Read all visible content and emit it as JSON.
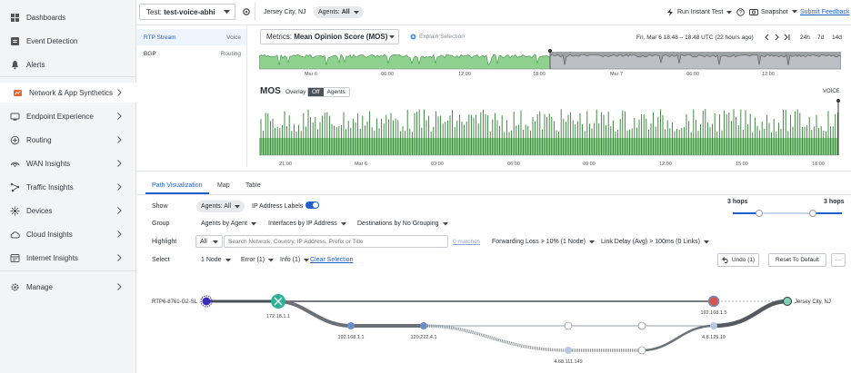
{
  "sidebar": {
    "items": [
      {
        "label": "Dashboards",
        "icon": "dashboard-icon"
      },
      {
        "label": "Event Detection",
        "icon": "event-detection-icon"
      },
      {
        "label": "Alerts",
        "icon": "bell-icon"
      },
      {
        "label": "Network & App Synthetics",
        "icon": "synthetics-icon"
      },
      {
        "label": "Endpoint Experience",
        "icon": "endpoint-icon"
      },
      {
        "label": "Routing",
        "icon": "routing-icon"
      },
      {
        "label": "WAN Insights",
        "icon": "wan-icon"
      },
      {
        "label": "Traffic Insights",
        "icon": "traffic-icon"
      },
      {
        "label": "Devices",
        "icon": "devices-icon"
      },
      {
        "label": "Cloud Insights",
        "icon": "cloud-icon"
      },
      {
        "label": "Internet Insights",
        "icon": "internet-icon"
      },
      {
        "label": "Manage",
        "icon": "gear-icon"
      }
    ]
  },
  "header": {
    "test_prefix": "Test:",
    "test_name": "test-voice-abhi",
    "location": "Jersey City, NJ",
    "agents_label": "Agents:",
    "agents_value": "All",
    "run_instant_test": "Run Instant Test",
    "snapshot": "Snapshot",
    "submit_feedback": "Submit Feedback"
  },
  "test_list": [
    {
      "name": "RTP Stream",
      "type": "Voice",
      "selected": true
    },
    {
      "name": "BGP",
      "type": "Routing",
      "selected": false
    }
  ],
  "metrics": {
    "label": "Metrics:",
    "value": "Mean Opinion Score (MOS)",
    "explain": "Explain Selection",
    "time_range": "Fri, Mar 6 18:48 – 18:48 UTC (22 hours ago)",
    "ranges": [
      "24h",
      "7d",
      "14d"
    ]
  },
  "timeline": {
    "ticks": [
      "Mar 6",
      "06:00",
      "12:00",
      "18:00",
      "Mar 7",
      "06:00",
      "12:00"
    ]
  },
  "mos_chart": {
    "title": "MOS",
    "overlay_label": "Overlay",
    "overlay_off": "Off",
    "overlay_agents": "Agents",
    "voice_label": "VOICE",
    "ticks": [
      "21:00",
      "Mar 6",
      "03:00",
      "06:00",
      "09:00",
      "12:00",
      "15:00",
      "18:00"
    ]
  },
  "tabs": [
    "Path Visualization",
    "Map",
    "Table"
  ],
  "controls": {
    "show_label": "Show",
    "agents_all": "Agents: All",
    "ip_labels": "IP Address Labels",
    "hops_left": "3 hops",
    "hops_right": "3 hops",
    "group_label": "Group",
    "group_by_agent": "Agents by Agent",
    "group_interfaces": "Interfaces by IP Address",
    "group_destinations": "Destinations by No Grouping",
    "highlight_label": "Highlight",
    "highlight_scope": "All",
    "search_placeholder": "Search Network, Country, IP Address, Prefix or Title",
    "matches": "0 matches",
    "forwarding_loss": "Forwarding Loss > 10% (1 Node)",
    "link_delay": "Link Delay (Avg) > 100ms (0 Links)",
    "select_label": "Select",
    "node_count": "1 Node",
    "error_count": "Error (1)",
    "info_count": "Info (1)",
    "clear_selection": "Clear Selection",
    "undo": "Undo (1)",
    "reset": "Reset To Default",
    "more": "···"
  },
  "path": {
    "source": "RTP6-8761-G2-SL",
    "destination": "Jersey City, NJ",
    "nodes": [
      "172.18.1.1",
      "192.168.1.1",
      "120.222.4.1",
      "4.68.111.149",
      "192.168.1.5",
      "4.8.125.10"
    ]
  },
  "colors": {
    "accent": "#1f5fcf",
    "green": "#3e8e41",
    "green_fill": "#8fd18f",
    "error": "#d9534f",
    "teal": "#2bb39a"
  }
}
